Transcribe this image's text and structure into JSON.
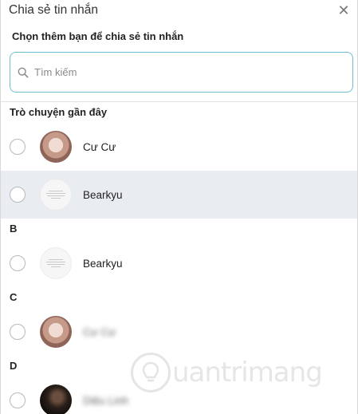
{
  "dialog": {
    "title": "Chia sẻ tin nhắn",
    "close_label": "✕",
    "subtitle": "Chọn thêm bạn để chia sẻ tin nhắn"
  },
  "search": {
    "placeholder": "Tìm kiếm",
    "value": ""
  },
  "sections": {
    "recent": "Trò chuyện gần đây",
    "b": "B",
    "c": "C",
    "d": "D"
  },
  "contacts": {
    "recent": [
      {
        "name": "Cư Cư",
        "avatar": "photo"
      },
      {
        "name": "Bearkyu",
        "avatar": "card"
      }
    ],
    "b": [
      {
        "name": "Bearkyu",
        "avatar": "card"
      }
    ],
    "c": [
      {
        "name": "Cư Cư",
        "avatar": "photo"
      }
    ],
    "d": [
      {
        "name": "Diệu Linh",
        "avatar": "dark"
      }
    ]
  },
  "colors": {
    "accent_border": "#6dbfd1",
    "hover_row": "#e9edf1"
  },
  "watermark": {
    "text": "uantrimang"
  }
}
